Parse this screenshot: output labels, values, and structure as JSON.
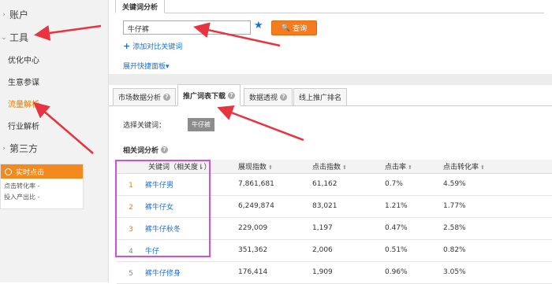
{
  "sidebar": {
    "account": "账户",
    "tools": "工具",
    "items": [
      "优化中心",
      "生意参谋",
      "流量解析",
      "行业解析"
    ],
    "third": "第三方",
    "realtime": {
      "title": "实时点击",
      "rows": [
        "点击转化率 -",
        "投入产出比 -"
      ]
    }
  },
  "main": {
    "top_tab": "关键词分析",
    "search_value": "牛仔裤",
    "query_button": "查询",
    "add_compare": "添加对比关键词",
    "expand_panel": "展开快捷面板",
    "tabs": [
      "市场数据分析",
      "推广词表下载",
      "数据透视",
      "线上推广排名"
    ],
    "select_kw_label": "选择关键词：",
    "select_kw_value": "牛仔裤",
    "related_title": "相关词分析"
  },
  "table": {
    "headers": [
      "关键词（相关度",
      "展现指数",
      "点击指数",
      "点击率",
      "点击转化率"
    ],
    "rows": [
      {
        "rank": "1",
        "kw": "裤牛仔男",
        "impr": "7,861,681",
        "click": "61,162",
        "ctr": "0.7%",
        "cvr": "4.59%"
      },
      {
        "rank": "2",
        "kw": "裤牛仔女",
        "impr": "6,249,874",
        "click": "83,021",
        "ctr": "1.21%",
        "cvr": "1.77%"
      },
      {
        "rank": "3",
        "kw": "裤牛仔秋冬",
        "impr": "229,009",
        "click": "1,197",
        "ctr": "0.47%",
        "cvr": "2.58%"
      },
      {
        "rank": "4",
        "kw": "牛仔",
        "impr": "351,362",
        "click": "2,006",
        "ctr": "0.51%",
        "cvr": "0.82%"
      },
      {
        "rank": "5",
        "kw": "裤牛仔修身",
        "impr": "176,414",
        "click": "1,909",
        "ctr": "0.96%",
        "cvr": "3.05%"
      }
    ]
  },
  "colors": {
    "accent": "#f47c1f",
    "link": "#1a6fd4",
    "annotation": "#e8343f",
    "highlight_box": "#d050d8"
  }
}
